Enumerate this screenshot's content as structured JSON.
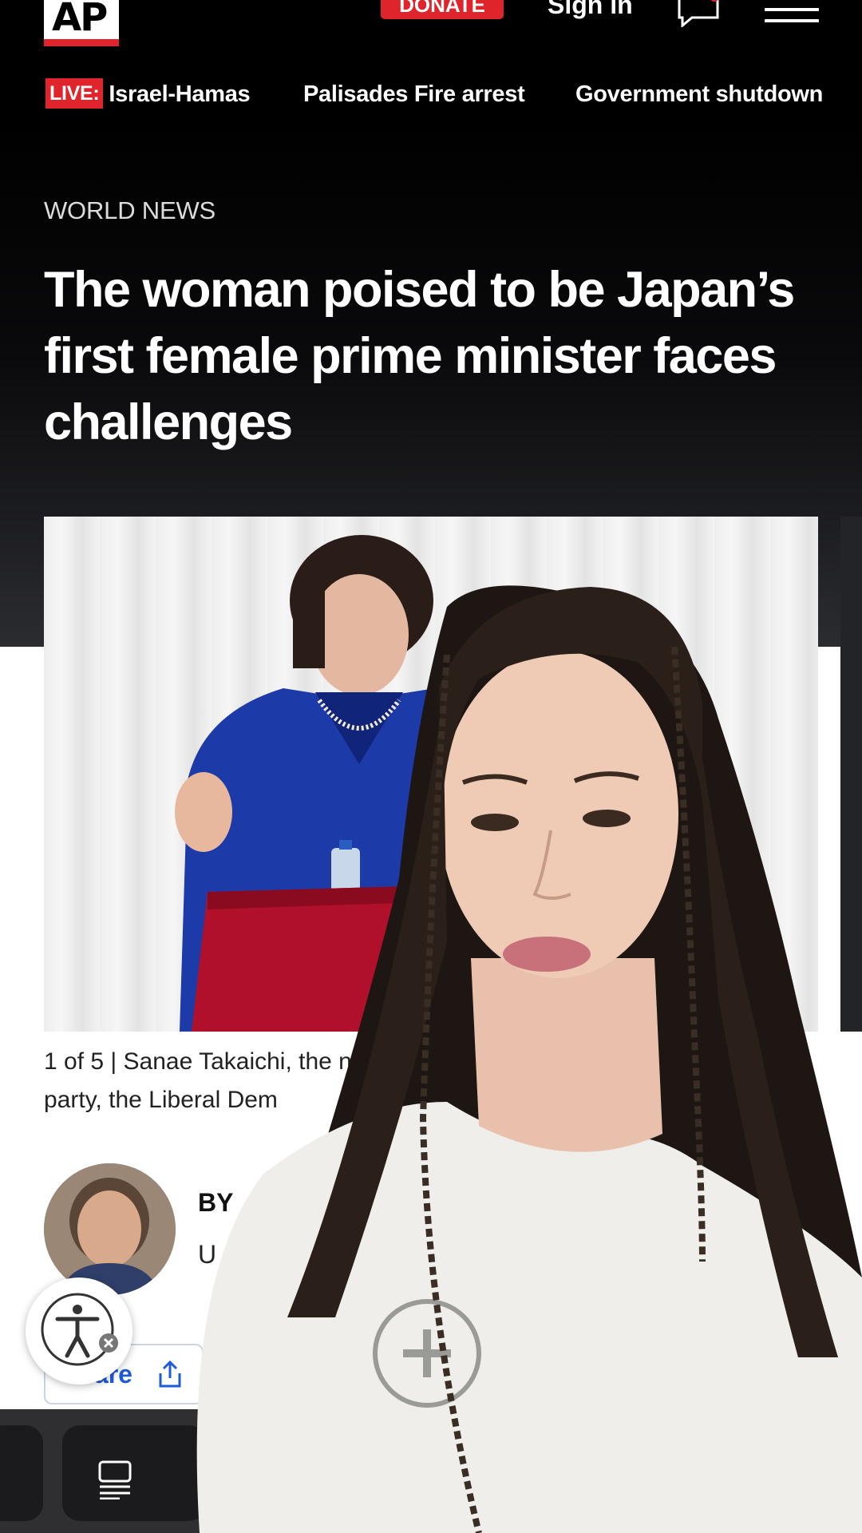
{
  "header": {
    "logo_text": "AP",
    "donate_label": "DONATE",
    "signin_label": "Sign in",
    "icons": [
      "chat-bubble-icon",
      "hamburger-menu-icon"
    ],
    "accent_color": "#e0242b"
  },
  "trending": {
    "live_badge": "LIVE:",
    "items": [
      "Israel-Hamas",
      "Palisades Fire arrest",
      "Government shutdown"
    ]
  },
  "article": {
    "section": "WORLD NEWS",
    "headline": "The woman poised to be Japan’s first female prime minister faces challenges",
    "caption_counter": "1 of 5 |",
    "caption_line1": "Sanae Takaichi, the n",
    "caption_line2": "party, the Liberal Dem",
    "byline": "BY",
    "byline_sub": "U",
    "share_label": "Share"
  },
  "bottom_bar": {
    "icons": [
      "reader-mode-icon",
      "accessibility-icon",
      "share-icon"
    ]
  }
}
